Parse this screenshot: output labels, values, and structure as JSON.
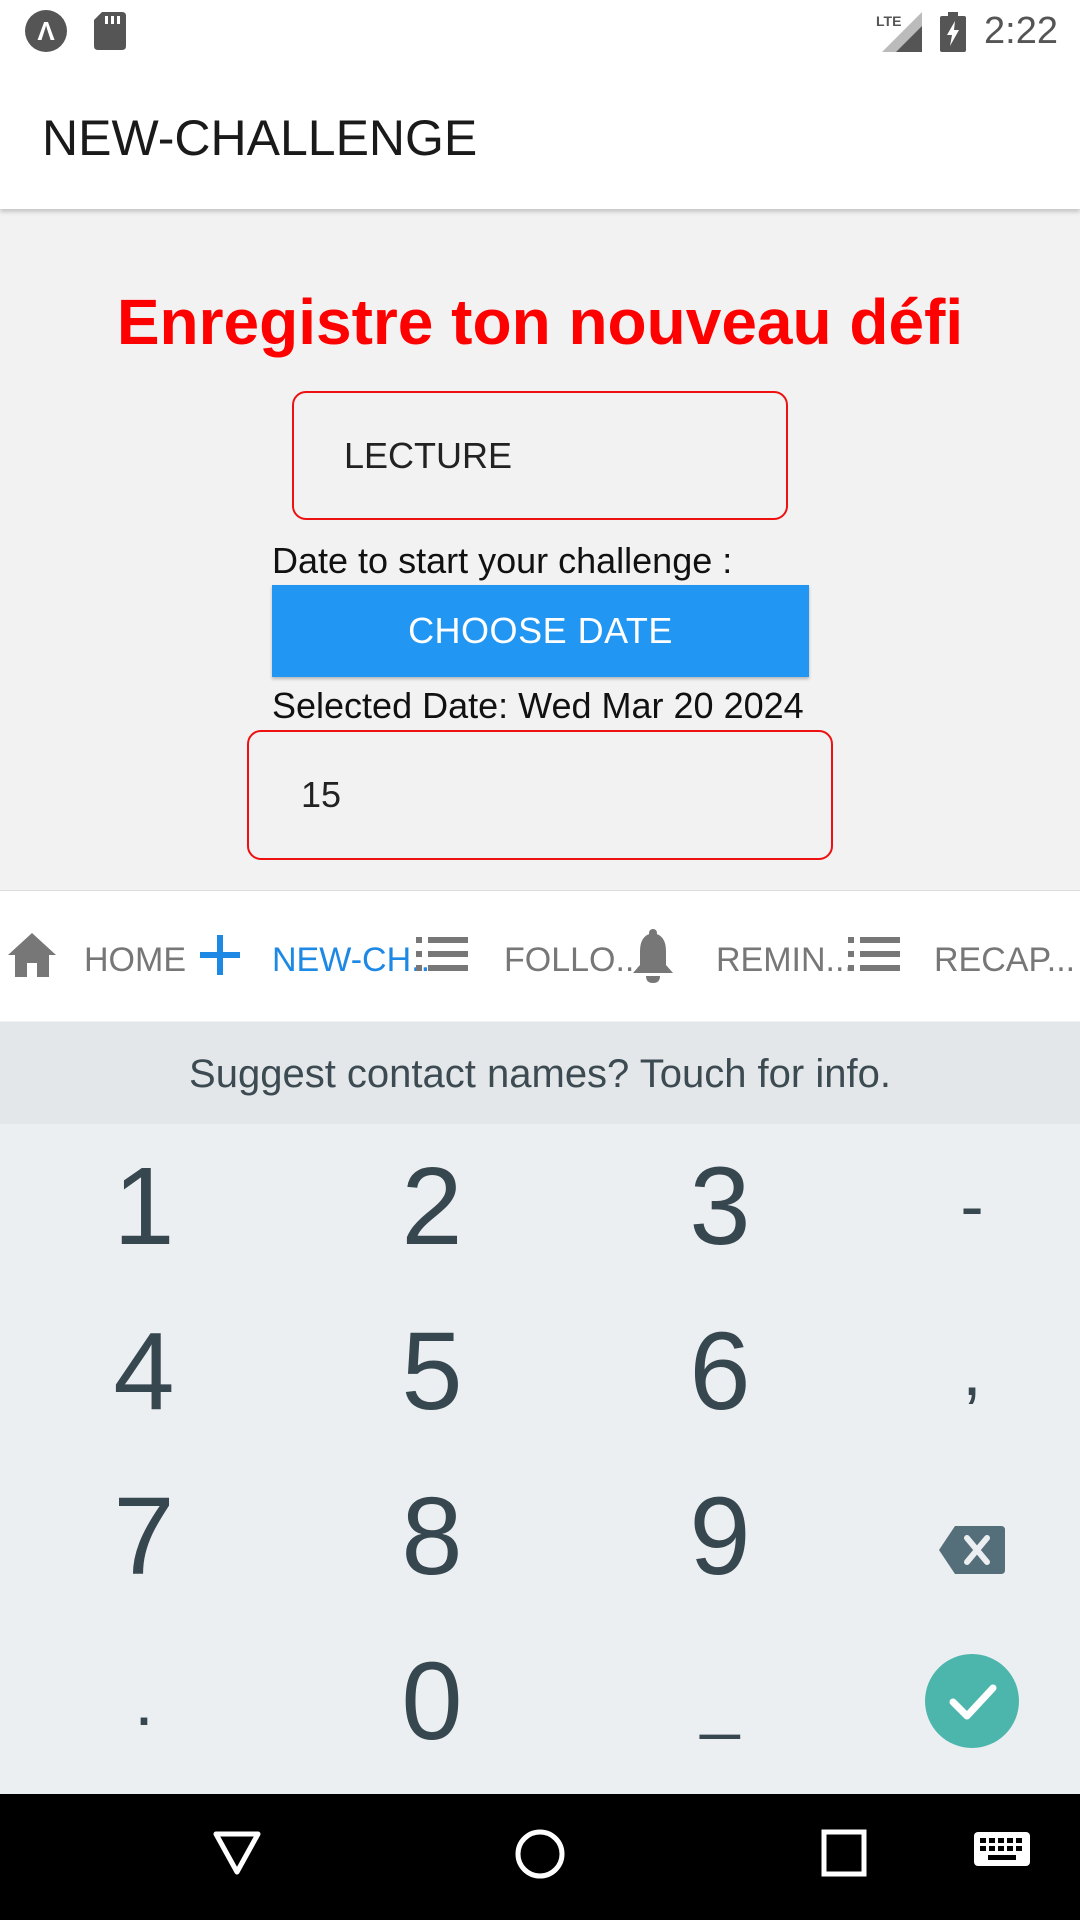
{
  "status_bar": {
    "time": "2:22",
    "app_icon_glyph": "Λ",
    "icons": [
      "app-logo-icon",
      "sd-card-icon",
      "lte-signal-icon",
      "battery-charging-icon"
    ],
    "network": "LTE"
  },
  "app_bar": {
    "title": "NEW-CHALLENGE"
  },
  "form": {
    "heading": "Enregistre ton nouveau défi",
    "challenge_name_value": "LECTURE",
    "date_label": "Date to start your challenge :",
    "choose_date_label": "CHOOSE DATE",
    "selected_date_text": "Selected Date: Wed Mar 20 2024",
    "days_value": "15"
  },
  "tabs": [
    {
      "label": "HOME",
      "icon": "home-icon",
      "active": false
    },
    {
      "label": "NEW-CH...",
      "icon": "plus-icon",
      "active": true
    },
    {
      "label": "FOLLO...",
      "icon": "list-icon",
      "active": false
    },
    {
      "label": "REMIN...",
      "icon": "bell-icon",
      "active": false
    },
    {
      "label": "RECAP...",
      "icon": "list-icon",
      "active": false
    }
  ],
  "keyboard": {
    "suggestion": "Suggest contact names? Touch for info.",
    "keys": [
      "1",
      "2",
      "3",
      "-",
      "4",
      "5",
      "6",
      ",",
      "7",
      "8",
      "9",
      "backspace",
      ".",
      "0",
      "_",
      "enter"
    ]
  },
  "colors": {
    "accent": "#2196f3",
    "heading_red": "#ff0000",
    "field_border": "#ee1111",
    "active_tab": "#1e88e5",
    "enter_key": "#4db6ac"
  }
}
